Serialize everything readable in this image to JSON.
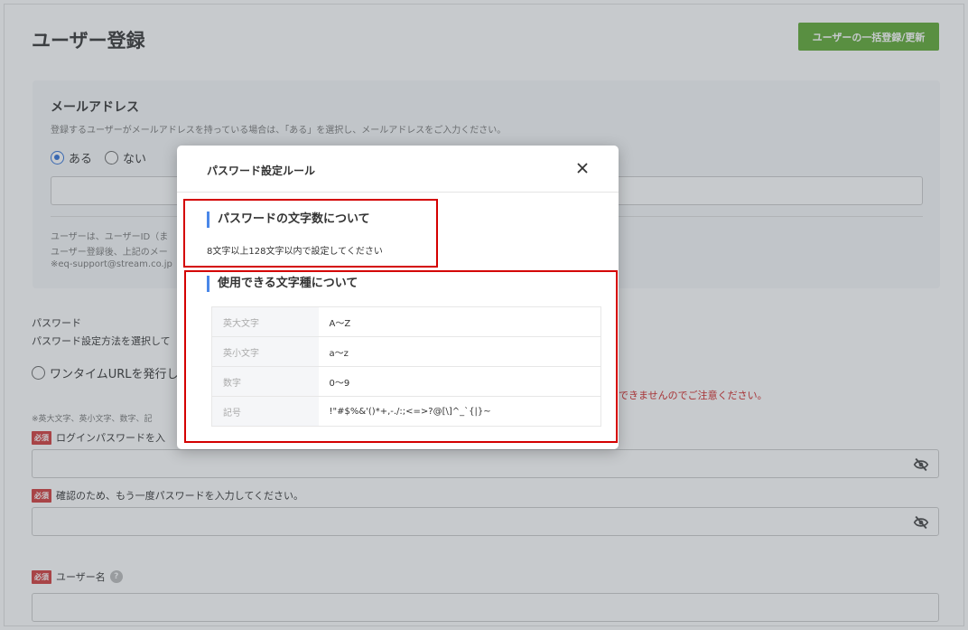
{
  "page": {
    "title": "ユーザー登録",
    "bulk_button": "ユーザーの一括登録/更新"
  },
  "email_section": {
    "title": "メールアドレス",
    "description": "登録するユーザーがメールアドレスを持っている場合は、「ある」を選択し、メールアドレスをご入力ください。",
    "options": [
      "ある",
      "ない"
    ],
    "selected": "ある",
    "notes": [
      "ユーザーは、ユーザーID（ま",
      "ユーザー登録後、上記のメー",
      "※eq-support@stream.co.jp"
    ]
  },
  "password_section": {
    "label": "パスワード",
    "description": "パスワード設定方法を選択して",
    "option_onetime": "ワンタイムURLを発行し",
    "warning": "できませんのでご注意ください。",
    "chars_note": "※英大文字、英小文字、数字、記"
  },
  "fields": {
    "required_badge": "必須",
    "login_password_label": "ログインパスワードを入",
    "confirm_password_label": "確認のため、もう一度パスワードを入力してください。",
    "username_label": "ユーザー名"
  },
  "modal": {
    "title": "パスワード設定ルール",
    "length_heading": "パスワードの文字数について",
    "length_text": "8文字以上128文字以内で設定してください",
    "types_heading": "使用できる文字種について",
    "char_types": [
      {
        "label": "英大文字",
        "value": "A〜Z"
      },
      {
        "label": "英小文字",
        "value": "a〜z"
      },
      {
        "label": "数字",
        "value": "0〜9"
      },
      {
        "label": "記号",
        "value": "!\"#$%&'()*+,-./:;<=>?@[\\]^_`{|}~"
      }
    ]
  },
  "colors": {
    "accent_blue": "#4a87e8",
    "button_green": "#5da932",
    "required_red": "#d23a3a",
    "highlight_red": "#d40000"
  },
  "icons": {
    "close": "close-icon",
    "eye": "eye-slash-icon",
    "help": "help-icon"
  }
}
